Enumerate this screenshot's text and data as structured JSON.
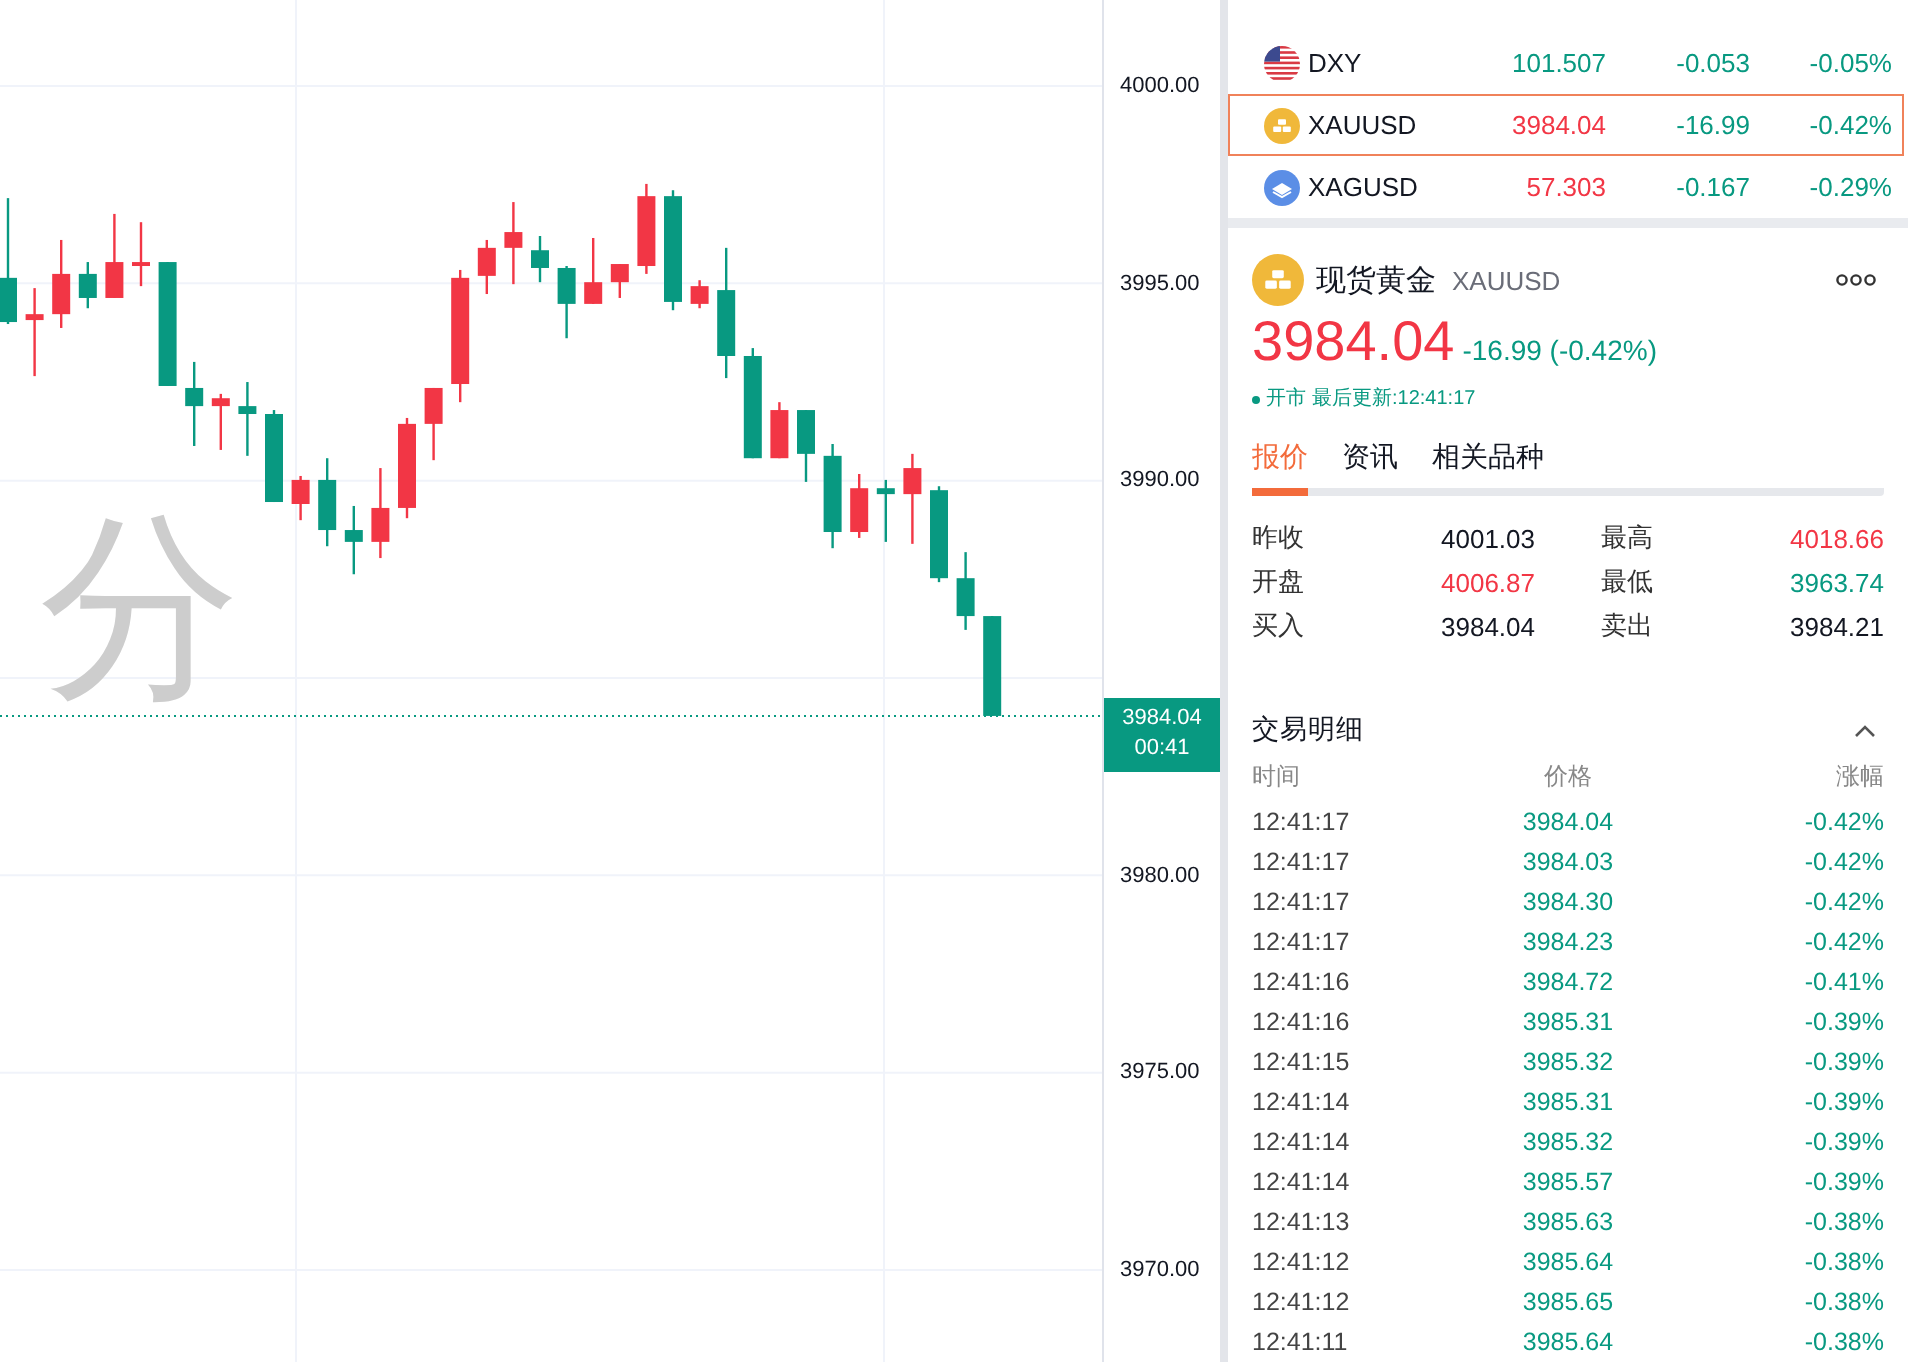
{
  "chart": {
    "watermark": "分",
    "chart_data": {
      "type": "candlestick",
      "grid": true,
      "ylim": [
        3967.67,
        4002.18
      ],
      "yticks": [
        {
          "value": 4000,
          "label": "4000.00"
        },
        {
          "value": 3995,
          "label": "3995.00"
        },
        {
          "value": 3990,
          "label": "3990.00"
        },
        {
          "value": 3980,
          "label": "3980.00"
        },
        {
          "value": 3975,
          "label": "3975.00"
        },
        {
          "value": 3970,
          "label": "3970.00"
        }
      ],
      "ref_lines": [
        {
          "axis": "y",
          "value": 3984.04,
          "label": "3984.04",
          "color": "#089981"
        }
      ],
      "ohlc": [
        [
          3995.14,
          3997.16,
          3993.97,
          3994.02
        ],
        [
          3994.07,
          3994.88,
          3992.65,
          3994.22
        ],
        [
          3994.22,
          3996.1,
          3993.87,
          3995.24
        ],
        [
          3995.24,
          3995.54,
          3994.37,
          3994.63
        ],
        [
          3994.63,
          3996.76,
          3994.63,
          3995.54
        ],
        [
          3995.44,
          3996.55,
          3994.93,
          3995.54
        ],
        [
          3995.54,
          3995.54,
          3992.4,
          3992.4
        ],
        [
          3992.35,
          3993.01,
          3990.88,
          3991.89
        ],
        [
          3991.89,
          3992.2,
          3990.78,
          3992.09
        ],
        [
          3991.89,
          3992.5,
          3990.63,
          3991.69
        ],
        [
          3991.69,
          3991.79,
          3989.46,
          3989.46
        ],
        [
          3989.41,
          3990.12,
          3989.0,
          3990.02
        ],
        [
          3990.02,
          3990.57,
          3988.34,
          3988.75
        ],
        [
          3988.75,
          3989.36,
          3987.63,
          3988.45
        ],
        [
          3988.45,
          3990.32,
          3988.04,
          3989.31
        ],
        [
          3989.31,
          3991.59,
          3989.05,
          3991.44
        ],
        [
          3991.44,
          3992.35,
          3990.52,
          3992.35
        ],
        [
          3992.45,
          3995.34,
          3991.99,
          3995.14
        ],
        [
          3995.19,
          3996.1,
          3994.73,
          3995.9
        ],
        [
          3995.9,
          3997.06,
          3994.98,
          3996.3
        ],
        [
          3995.84,
          3996.2,
          3995.03,
          3995.39
        ],
        [
          3995.39,
          3995.44,
          3993.61,
          3994.48
        ],
        [
          3994.48,
          3996.15,
          3994.48,
          3995.03
        ],
        [
          3995.03,
          3995.49,
          3994.63,
          3995.49
        ],
        [
          3995.44,
          3997.52,
          3995.24,
          3997.21
        ],
        [
          3997.21,
          3997.36,
          3994.32,
          3994.53
        ],
        [
          3994.48,
          3995.08,
          3994.37,
          3994.93
        ],
        [
          3994.83,
          3995.9,
          3992.6,
          3993.16
        ],
        [
          3993.16,
          3993.36,
          3990.57,
          3990.57
        ],
        [
          3990.57,
          3991.99,
          3990.57,
          3991.79
        ],
        [
          3991.79,
          3991.79,
          3989.97,
          3990.68
        ],
        [
          3990.63,
          3990.93,
          3988.29,
          3988.7
        ],
        [
          3988.7,
          3990.17,
          3988.55,
          3989.81
        ],
        [
          3989.81,
          3990.02,
          3988.45,
          3989.66
        ],
        [
          3989.66,
          3990.68,
          3988.4,
          3990.32
        ],
        [
          3989.76,
          3989.86,
          3987.43,
          3987.53
        ],
        [
          3987.53,
          3988.19,
          3986.22,
          3986.57
        ],
        [
          3986.57,
          3986.57,
          3984.04,
          3984.04
        ]
      ]
    },
    "countdown": "00:41"
  },
  "watchlist": [
    {
      "kind": "usd",
      "symbol": "DXY",
      "price": "101.507",
      "color": "#089981",
      "change": "-0.053",
      "change_pct": "-0.05%",
      "selected": false
    },
    {
      "kind": "gold",
      "symbol": "XAUUSD",
      "price": "3984.04",
      "color": "#f23645",
      "change": "-16.99",
      "change_pct": "-0.42%",
      "selected": true
    },
    {
      "kind": "silver",
      "symbol": "XAGUSD",
      "price": "57.303",
      "color": "#f23645",
      "change": "-0.167",
      "change_pct": "-0.29%",
      "selected": false
    }
  ],
  "quote": {
    "kind": "gold",
    "name": "现货黄金",
    "symbol": "XAUUSD",
    "price": "3984.04",
    "color": "#f23645",
    "change": "-16.99 (-0.42%)",
    "status": "开市",
    "updated": "最后更新:12:41:17"
  },
  "tabs": [
    {
      "label": "报价",
      "selected": true
    },
    {
      "label": "资讯",
      "selected": false
    },
    {
      "label": "相关品种",
      "selected": false
    }
  ],
  "stats": [
    {
      "label": "昨收",
      "value": "4001.03",
      "color": "#131722"
    },
    {
      "label": "最高",
      "value": "4018.66",
      "color": "#f23645"
    },
    {
      "label": "开盘",
      "value": "4006.87",
      "color": "#f23645"
    },
    {
      "label": "最低",
      "value": "3963.74",
      "color": "#089981"
    },
    {
      "label": "买入",
      "value": "3984.04",
      "color": "#131722"
    },
    {
      "label": "卖出",
      "value": "3984.21",
      "color": "#131722"
    }
  ],
  "trades": {
    "title": "交易明细",
    "expanded": true,
    "columns": [
      "时间",
      "价格",
      "涨幅"
    ],
    "rows": [
      {
        "time": "12:41:17",
        "price": "3984.04",
        "change_pct": "-0.42%"
      },
      {
        "time": "12:41:17",
        "price": "3984.03",
        "change_pct": "-0.42%"
      },
      {
        "time": "12:41:17",
        "price": "3984.30",
        "change_pct": "-0.42%"
      },
      {
        "time": "12:41:17",
        "price": "3984.23",
        "change_pct": "-0.42%"
      },
      {
        "time": "12:41:16",
        "price": "3984.72",
        "change_pct": "-0.41%"
      },
      {
        "time": "12:41:16",
        "price": "3985.31",
        "change_pct": "-0.39%"
      },
      {
        "time": "12:41:15",
        "price": "3985.32",
        "change_pct": "-0.39%"
      },
      {
        "time": "12:41:14",
        "price": "3985.31",
        "change_pct": "-0.39%"
      },
      {
        "time": "12:41:14",
        "price": "3985.32",
        "change_pct": "-0.39%"
      },
      {
        "time": "12:41:14",
        "price": "3985.57",
        "change_pct": "-0.39%"
      },
      {
        "time": "12:41:13",
        "price": "3985.63",
        "change_pct": "-0.38%"
      },
      {
        "time": "12:41:12",
        "price": "3985.64",
        "change_pct": "-0.38%"
      },
      {
        "time": "12:41:12",
        "price": "3985.65",
        "change_pct": "-0.38%"
      },
      {
        "time": "12:41:11",
        "price": "3985.64",
        "change_pct": "-0.38%"
      }
    ]
  }
}
